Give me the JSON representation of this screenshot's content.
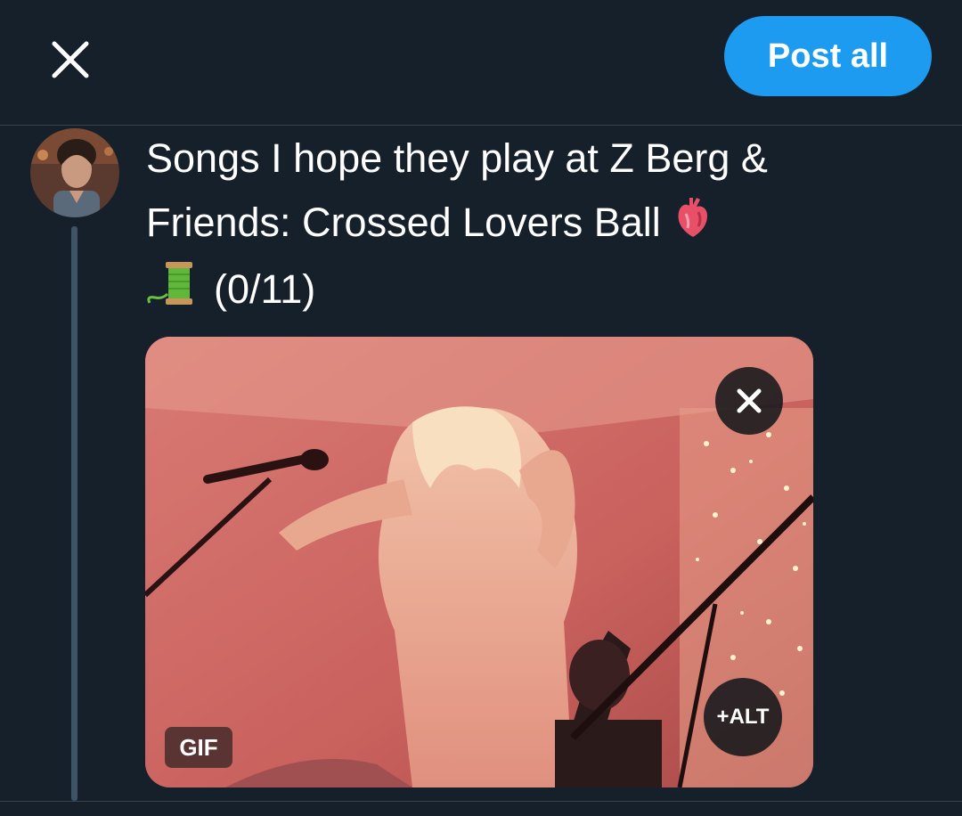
{
  "header": {
    "close_icon": "close-icon",
    "post_all_label": "Post all"
  },
  "composer": {
    "avatar_icon": "user-avatar",
    "text_line_1": "Songs I hope they play at Z Berg &",
    "text_line_2": "Friends: Crossed Lovers Ball",
    "text_line_3": "(0/11)",
    "emoji_1": "anatomical-heart-emoji",
    "emoji_2": "thread-spool-emoji"
  },
  "media": {
    "gif_label": "GIF",
    "alt_label": "+ALT",
    "remove_icon": "close-icon"
  },
  "colors": {
    "background": "#15202b",
    "accent": "#1d9bf0",
    "divider": "#38444d",
    "thread_line": "#3d5466"
  }
}
